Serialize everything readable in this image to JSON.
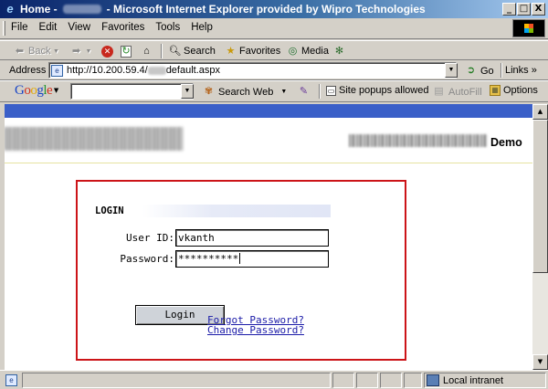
{
  "window": {
    "title_start": "Home -",
    "title_end": "- Microsoft Internet Explorer provided by Wipro Technologies",
    "minimize": "_",
    "maximize": "□",
    "close": "X"
  },
  "menu": {
    "items": [
      "File",
      "Edit",
      "View",
      "Favorites",
      "Tools",
      "Help"
    ]
  },
  "toolbar": {
    "back": "Back",
    "search": "Search",
    "favorites": "Favorites",
    "media": "Media"
  },
  "address": {
    "label": "Address",
    "url_prefix": "http://10.200.59.4/",
    "url_suffix": "default.aspx",
    "go": "Go",
    "links": "Links"
  },
  "googlebar": {
    "logo_letters": [
      "G",
      "o",
      "o",
      "g",
      "l",
      "e"
    ],
    "search_web": "Search Web",
    "popups": "Site popups allowed",
    "autofill": "AutoFill",
    "options": "Options"
  },
  "page": {
    "header_right": "Demo",
    "login": {
      "title": "LOGIN",
      "userid_label": "User ID:",
      "userid_value": "vkanth",
      "password_label": "Password:",
      "password_value": "**********",
      "button": "Login",
      "forgot_link": "Forgot Password?",
      "change_link": "Change Password?"
    }
  },
  "status": {
    "zone": "Local intranet"
  },
  "colors": {
    "title_gradient_start": "#0a246a",
    "page_band": "#3a5fc8",
    "login_border": "#cc1418",
    "link": "#1b1ba8"
  }
}
